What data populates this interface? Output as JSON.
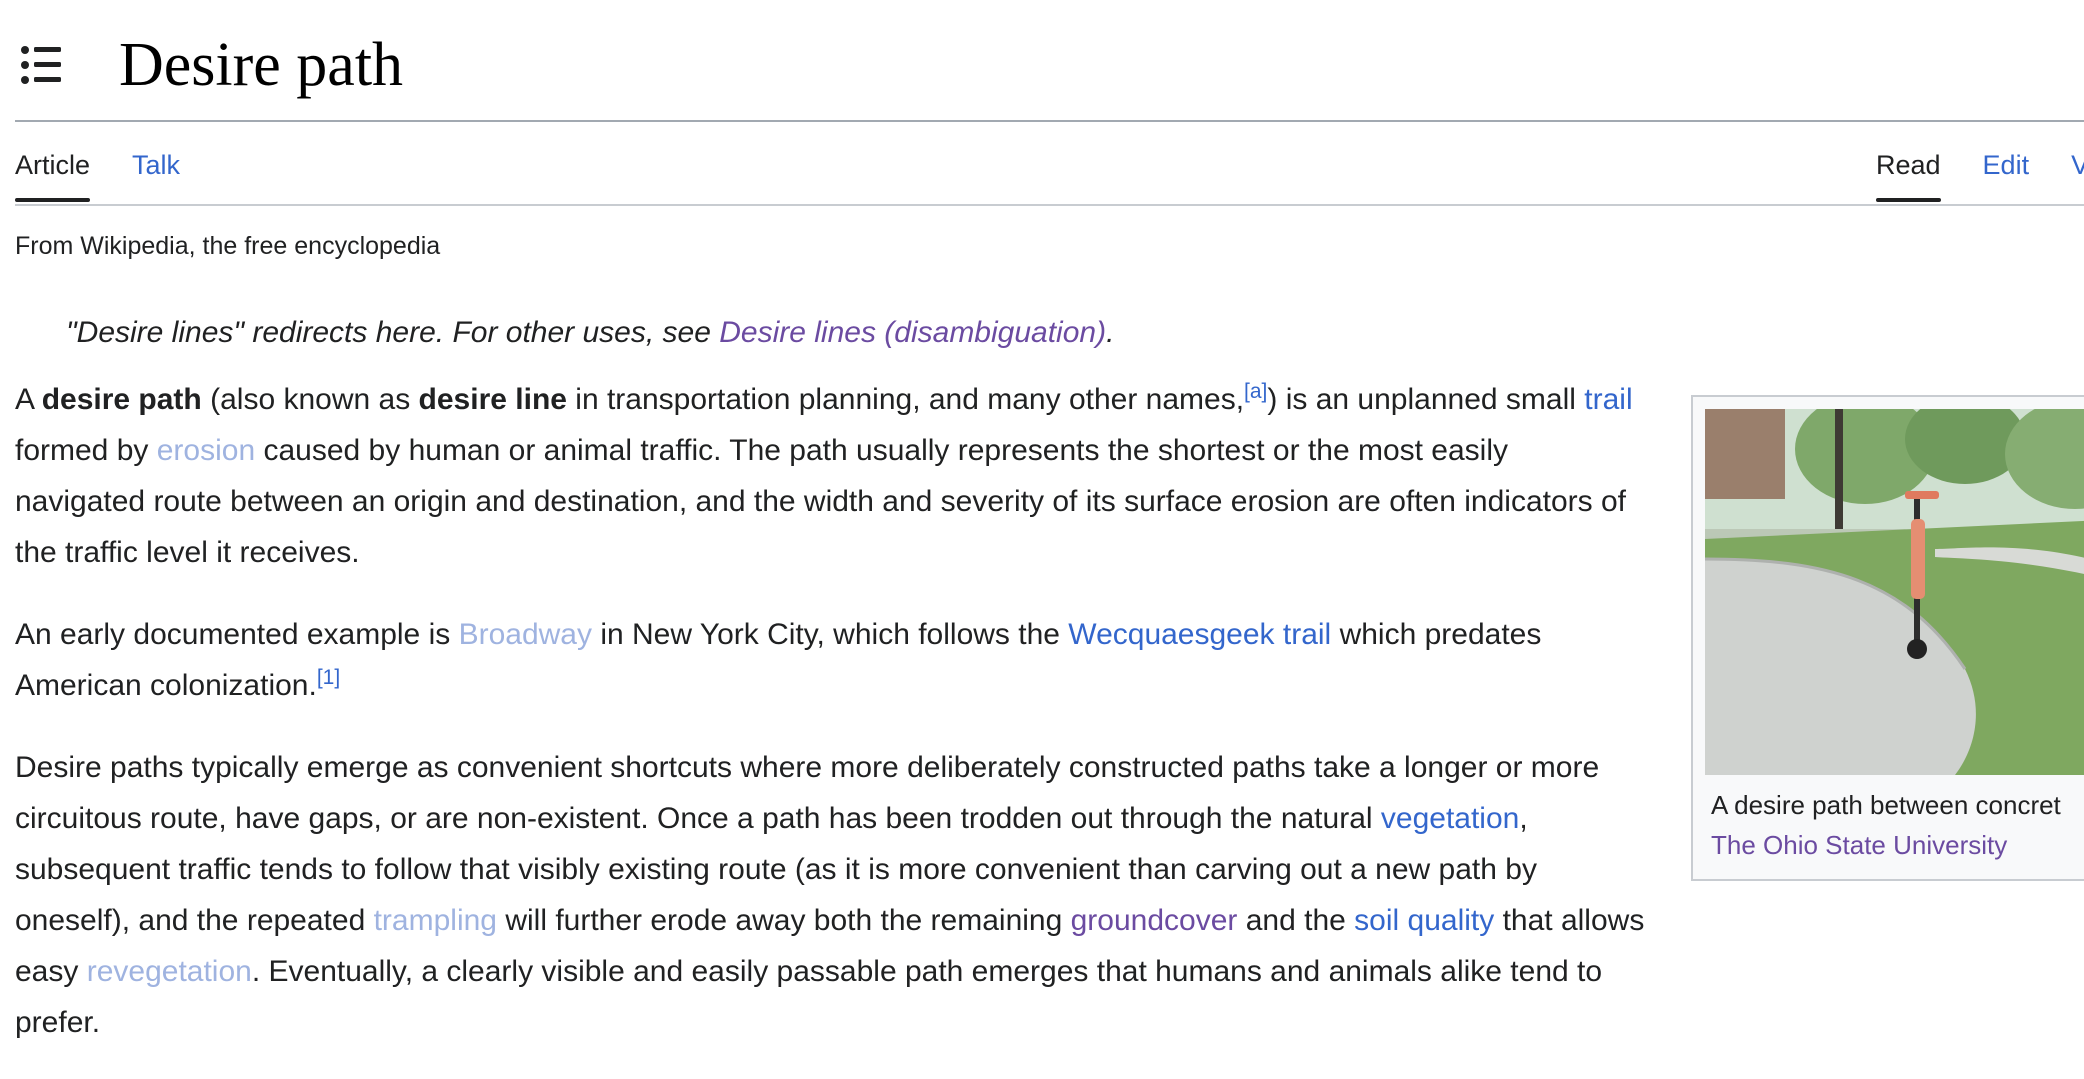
{
  "header": {
    "title": "Desire path",
    "toc_icon": "list-icon"
  },
  "tabs": {
    "left": [
      {
        "label": "Article",
        "selected": true
      },
      {
        "label": "Talk",
        "selected": false
      }
    ],
    "right": [
      {
        "label": "Read",
        "selected": true
      },
      {
        "label": "Edit",
        "selected": false
      },
      {
        "label": "V",
        "selected": false
      }
    ]
  },
  "tagline": "From Wikipedia, the free encyclopedia",
  "hatnote": {
    "text": "\"Desire lines\" redirects here. For other uses, see ",
    "link": "Desire lines (disambiguation)",
    "end": "."
  },
  "paragraphs": {
    "p1": {
      "t1": "A ",
      "b1": "desire path",
      "t2": " (also known as ",
      "b2": "desire line",
      "t3": " in transportation planning, and many other names,",
      "ref": "[a]",
      "t4": ") is an unplanned small ",
      "l1": "trail",
      "t5": " formed by ",
      "l2": "erosion",
      "t6": " caused by human or animal traffic. The path usually represents the shortest or the most easily navigated route between an origin and destination, and the width and severity of its surface erosion are often indicators of the traffic level it receives."
    },
    "p2": {
      "t1": "An early documented example is ",
      "l1": "Broadway",
      "t2": " in New York City, which follows the ",
      "l2": "Wecquaesgeek trail",
      "t3": " which predates American colonization.",
      "ref": "[1]"
    },
    "p3": {
      "t1": "Desire paths typically emerge as convenient shortcuts where more deliberately constructed paths take a longer or more circuitous route, have gaps, or are non-existent. Once a path has been trodden out through the natural ",
      "l1": "vegetation",
      "t2": ", subsequent traffic tends to follow that visibly existing route (as it is more convenient than carving out a new path by oneself), and the repeated ",
      "l2": "trampling",
      "t3": " will further erode away both the remaining ",
      "l3": "groundcover",
      "t4": " and the ",
      "l4": "soil quality",
      "t5": " that allows easy ",
      "l5": "revegetation",
      "t6": ". Eventually, a clearly visible and easily passable path emerges that humans and animals alike tend to prefer."
    }
  },
  "infobox": {
    "caption_text": "A desire path between concret",
    "caption_link": "The Ohio State University"
  }
}
